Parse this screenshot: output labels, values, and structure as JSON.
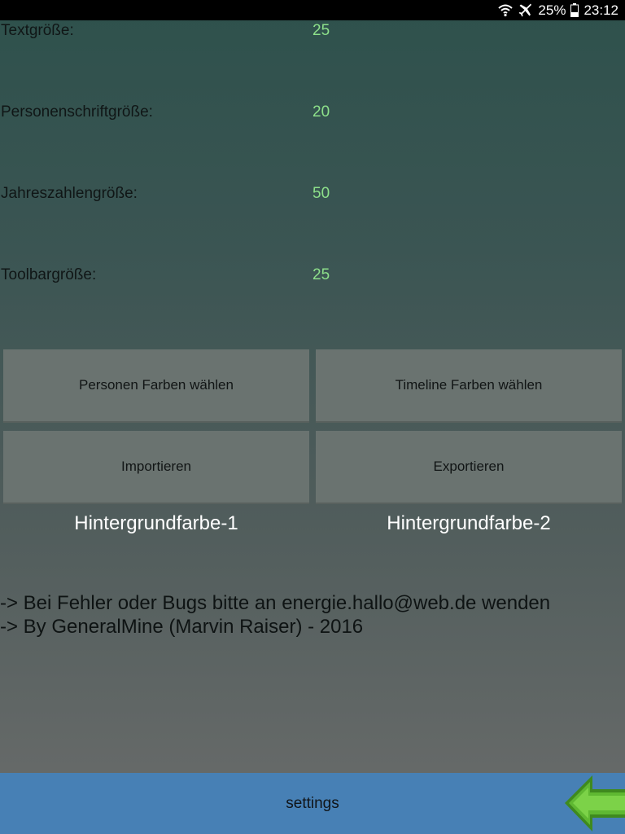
{
  "status_bar": {
    "icons": [
      "wifi-icon",
      "airplane-icon",
      "battery-icon"
    ],
    "battery": "25%",
    "time": "23:12"
  },
  "settings": [
    {
      "label": "Textgröße:",
      "value": "25"
    },
    {
      "label": "Personenschriftgröße:",
      "value": "20"
    },
    {
      "label": "Jahreszahlengröße:",
      "value": "50"
    },
    {
      "label": "Toolbargröße:",
      "value": "25"
    }
  ],
  "buttons": {
    "person_colors": "Personen Farben wählen",
    "timeline_colors": "Timeline Farben wählen",
    "import": "Importieren",
    "export": "Exportieren"
  },
  "background": {
    "color1_label": "Hintergrundfarbe-1",
    "color2_label": "Hintergrundfarbe-2"
  },
  "info": {
    "line1": "-> Bei Fehler oder Bugs bitte an energie.hallo@web.de wenden",
    "line2": "-> By GeneralMine (Marvin Raiser) - 2016"
  },
  "bottom_bar": {
    "title": "settings",
    "back_icon": "green-arrow-left-icon"
  },
  "colors": {
    "value_text": "#8de08a",
    "bottom_bar": "#4780b5",
    "button_bg": "#6a7370",
    "arrow_fill": "#5fb832"
  }
}
